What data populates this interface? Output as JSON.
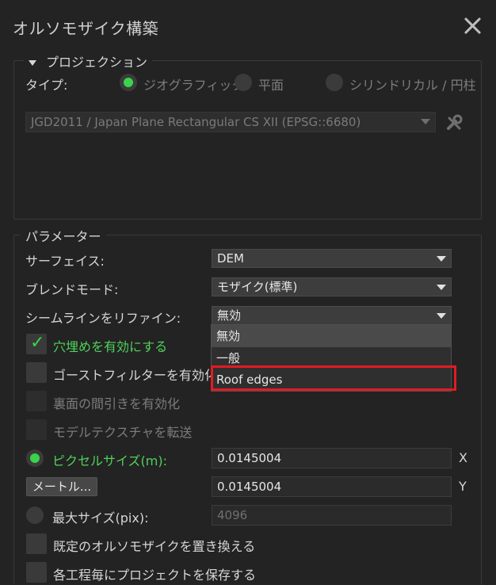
{
  "window": {
    "title": "オルソモザイク構築"
  },
  "projection": {
    "legend": "プロジェクション",
    "type_label": "タイプ:",
    "types": [
      {
        "label": "ジオグラフィック",
        "selected": true
      },
      {
        "label": "平面",
        "selected": false
      },
      {
        "label": "シリンドリカル / 円柱",
        "selected": false
      }
    ],
    "crs": "JGD2011 / Japan Plane Rectangular CS XII (EPSG::6680)",
    "crs_tool_icon": "tools-icon"
  },
  "parameters": {
    "legend": "パラメーター",
    "surface": {
      "label": "サーフェイス:",
      "value": "DEM"
    },
    "blend": {
      "label": "ブレンドモード:",
      "value": "モザイク(標準)"
    },
    "seamline": {
      "label": "シームラインをリファイン:",
      "value": "無効",
      "options": [
        "無効",
        "一般",
        "Roof edges"
      ],
      "highlighted_option": "Roof edges"
    },
    "checks": [
      {
        "label": "穴埋めを有効にする",
        "checked": true,
        "enabled": true
      },
      {
        "label": "ゴーストフィルターを有効化",
        "checked": false,
        "enabled": true
      },
      {
        "label": "裏面の間引きを有効化",
        "checked": false,
        "enabled": false
      },
      {
        "label": "モデルテクスチャを転送",
        "checked": false,
        "enabled": false
      }
    ],
    "pixel_size": {
      "label": "ピクセルサイズ(m):",
      "x": "0.0145004",
      "y": "0.0145004",
      "x_axis": "X",
      "y_axis": "Y",
      "selected": true
    },
    "meters_button": "メートル...",
    "max_size": {
      "label": "最大サイズ(pix):",
      "value": "4096",
      "selected": false
    },
    "checks2": [
      {
        "label": "既定のオルソモザイクを置き換える",
        "checked": false
      },
      {
        "label": "各工程毎にプロジェクトを保存する",
        "checked": false
      }
    ]
  },
  "colors": {
    "accent_green": "#39d44a",
    "highlight_red": "#e21b24"
  }
}
